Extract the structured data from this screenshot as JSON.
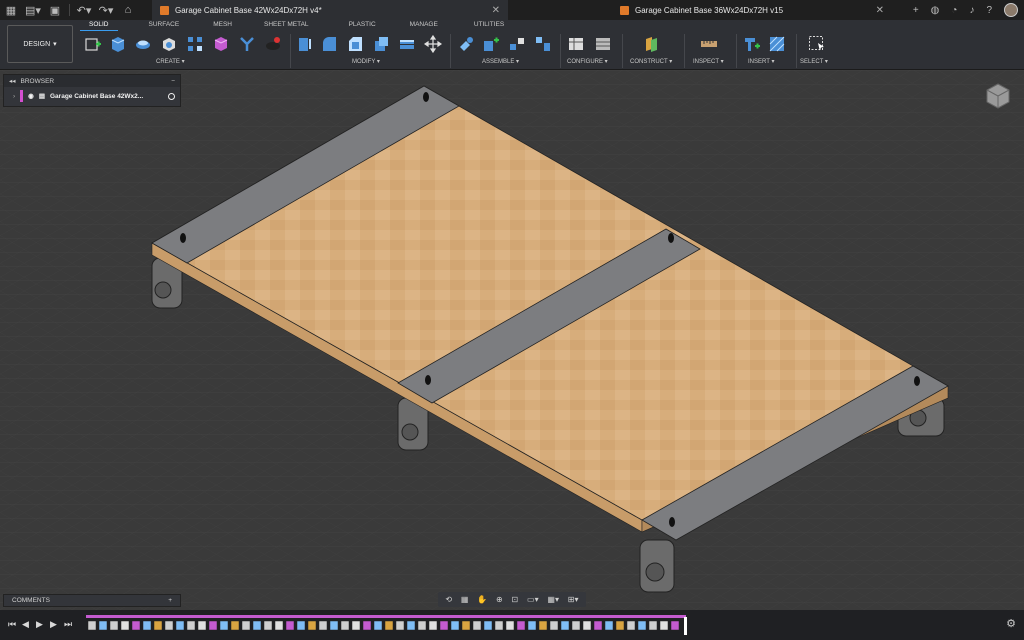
{
  "titlebar": {
    "active_tab": "Garage Cabinet Base 42Wx24Dx72H v4*",
    "inactive_tab": "Garage Cabinet Base 36Wx24Dx72H v15"
  },
  "toolbar": {
    "workspace": "DESIGN",
    "tabs": [
      "SOLID",
      "SURFACE",
      "MESH",
      "SHEET METAL",
      "PLASTIC",
      "MANAGE",
      "UTILITIES"
    ],
    "groups": [
      "CREATE",
      "MODIFY",
      "ASSEMBLE",
      "CONFIGURE",
      "CONSTRUCT",
      "INSPECT",
      "INSERT",
      "SELECT"
    ]
  },
  "browser": {
    "title": "BROWSER",
    "item": "Garage Cabinet Base 42Wx2..."
  },
  "comments": {
    "title": "COMMENTS"
  },
  "colors": {
    "accent": "#3a9df0",
    "plywood": "#d7ad7b",
    "steel": "#7c7d80",
    "grid": "#454545"
  }
}
